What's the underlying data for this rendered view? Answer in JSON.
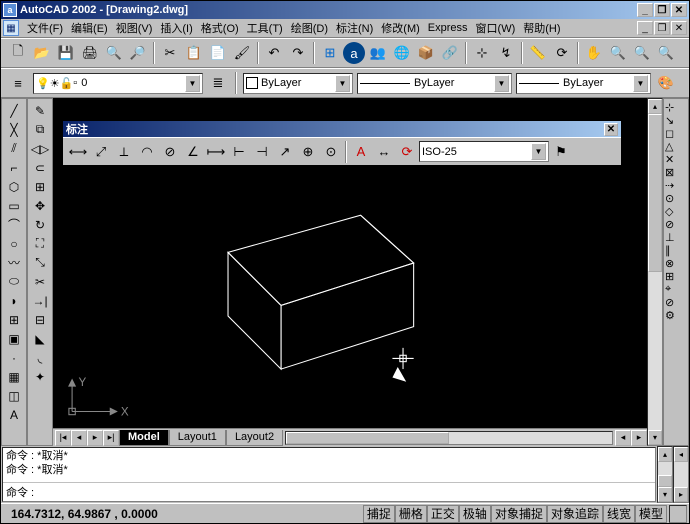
{
  "title": "AutoCAD 2002 - [Drawing2.dwg]",
  "menus": {
    "file": "文件(F)",
    "edit": "编辑(E)",
    "view": "视图(V)",
    "insert": "插入(I)",
    "format": "格式(O)",
    "tools": "工具(T)",
    "draw": "绘图(D)",
    "dimension": "标注(N)",
    "modify": "修改(M)",
    "express": "Express",
    "window": "窗口(W)",
    "help": "帮助(H)"
  },
  "layer_dropdown": "0",
  "prop_color": "ByLayer",
  "prop_ltype": "ByLayer",
  "prop_lweight": "ByLayer",
  "float_title": "标注",
  "dim_style": "ISO-25",
  "tabs": {
    "model": "Model",
    "layout1": "Layout1",
    "layout2": "Layout2"
  },
  "cmd_lines": [
    "命令 : *取消*",
    "命令 : *取消*"
  ],
  "cmd_prompt": "命令 :",
  "coords": "164.7312, 64.9867 , 0.0000",
  "status": {
    "snap": "捕捉",
    "grid": "栅格",
    "ortho": "正交",
    "polar": "极轴",
    "osnap": "对象捕捉",
    "otrack": "对象追踪",
    "lwt": "线宽",
    "model": "模型"
  },
  "ucs": {
    "x": "X",
    "y": "Y"
  }
}
